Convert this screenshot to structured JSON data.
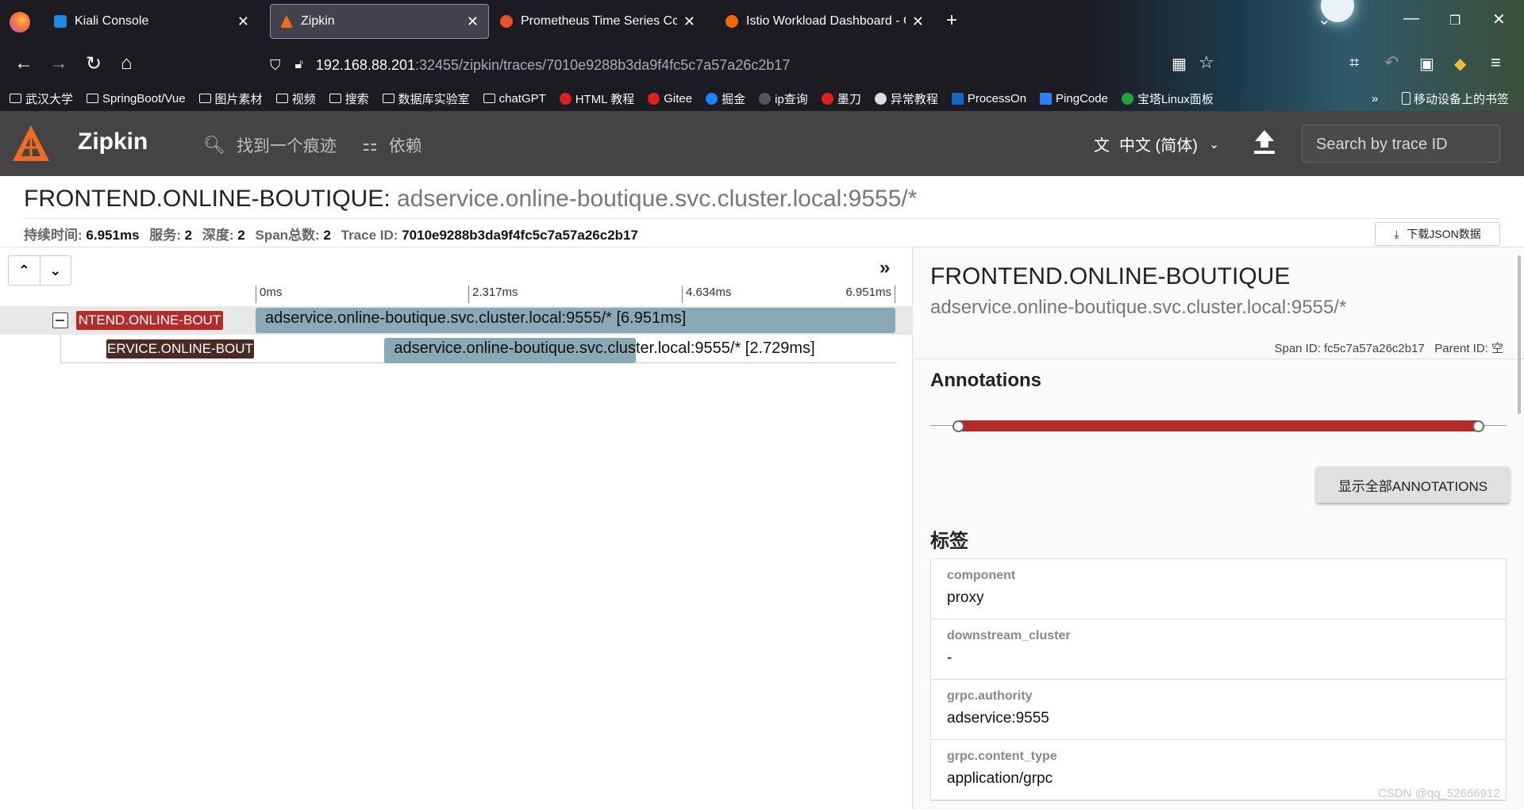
{
  "browser": {
    "tabs": [
      {
        "title": "Kiali Console",
        "color": "#1e88e5"
      },
      {
        "title": "Zipkin",
        "color": "#f06a22"
      },
      {
        "title": "Prometheus Time Series Coll",
        "color": "#e6522c"
      },
      {
        "title": "Istio Workload Dashboard - G",
        "color": "#f46800"
      }
    ],
    "url_host": "192.168.88.201",
    "url_path": ":32455/zipkin/traces/7010e9288b3da9f4fc5c7a57a26c2b17",
    "bookmarks": [
      "武汉大学",
      "SpringBoot/Vue",
      "图片素材",
      "视频",
      "搜索",
      "数据库实验室",
      "chatGPT",
      "HTML 教程",
      "Gitee",
      "掘金",
      "ip查询",
      "墨刀",
      "异常教程",
      "ProcessOn",
      "PingCode",
      "宝塔Linux面板"
    ],
    "mobile_bookmarks": "移动设备上的书签"
  },
  "app": {
    "brand": "Zipkin",
    "nav": {
      "find": "找到一个痕迹",
      "deps": "依赖"
    },
    "language": "中文 (简体)",
    "search_placeholder": "Search by trace ID"
  },
  "trace": {
    "service": "FRONTEND.ONLINE-BOUTIQUE:",
    "name": " adservice.online-boutique.svc.cluster.local:9555/*",
    "duration_label": "持续时间:",
    "duration": "6.951ms",
    "services_label": "服务:",
    "services": "2",
    "depth_label": "深度:",
    "depth": "2",
    "spans_label": "Span总数:",
    "spans": "2",
    "traceid_label": "Trace ID:",
    "traceid": "7010e9288b3da9f4fc5c7a57a26c2b17",
    "download": "下载JSON数据"
  },
  "timeline": {
    "ticks": [
      "0ms",
      "2.317ms",
      "4.634ms",
      "6.951ms"
    ],
    "spans": [
      {
        "service": "FRONTEND.ONLINE-BOUTIQUE",
        "service_shown": "NTEND.ONLINE-BOUT",
        "label": "adservice.online-boutique.svc.cluster.local:9555/* [6.951ms]",
        "start_ms": 0,
        "duration_ms": 6.951,
        "color": "#b32b2b"
      },
      {
        "service": "ADSERVICE.ONLINE-BOUTIQUE",
        "service_shown": "ERVICE.ONLINE-BOUT",
        "label": "adservice.online-boutique.svc.cluster.local:9555/* [2.729ms]",
        "start_ms": 1.4,
        "duration_ms": 2.729,
        "color": "#4a2a22"
      }
    ]
  },
  "detail": {
    "service": "FRONTEND.ONLINE-BOUTIQUE",
    "name": "adservice.online-boutique.svc.cluster.local:9555/*",
    "span_id": "Span ID: fc5c7a57a26c2b17",
    "parent_id": "Parent ID: 空",
    "annotations_title": "Annotations",
    "show_all": "显示全部ANNOTATIONS",
    "tags_title": "标签",
    "tags": [
      {
        "key": "component",
        "value": "proxy"
      },
      {
        "key": "downstream_cluster",
        "value": "-"
      },
      {
        "key": "grpc.authority",
        "value": "adservice:9555"
      },
      {
        "key": "grpc.content_type",
        "value": "application/grpc"
      }
    ]
  },
  "watermark": "CSDN @qq_52666912"
}
